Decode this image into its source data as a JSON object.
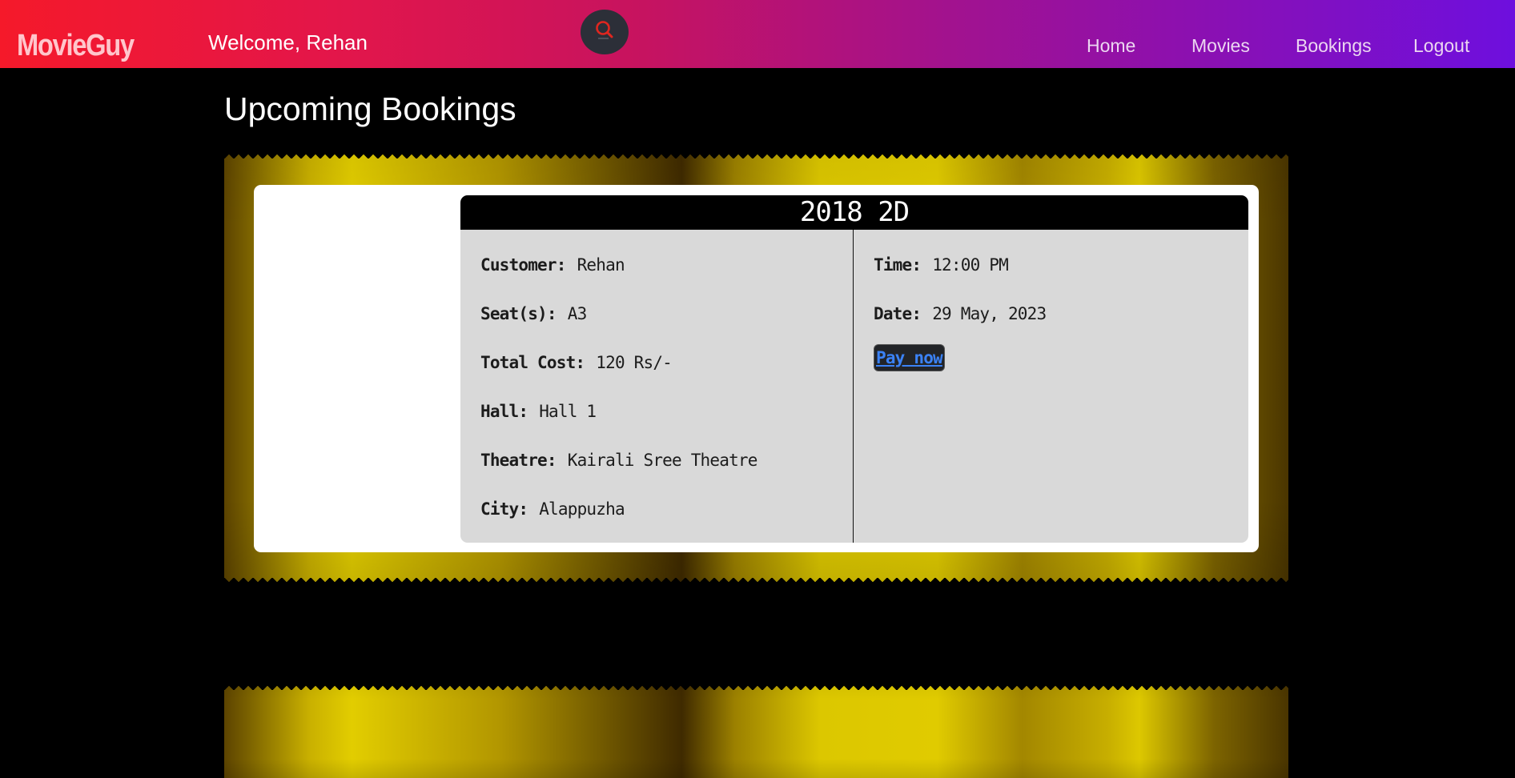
{
  "header": {
    "logo": "MovieGuy",
    "welcome": "Welcome, Rehan",
    "search_icon": "search-icon",
    "nav": {
      "home": "Home",
      "movies": "Movies",
      "bookings": "Bookings",
      "logout": "Logout"
    }
  },
  "main": {
    "title": "Upcoming Bookings"
  },
  "bookings": [
    {
      "movie": "2018 2D",
      "customer_label": "Customer:",
      "customer": "Rehan",
      "seats_label": "Seat(s):",
      "seats": "A3",
      "cost_label": "Total Cost:",
      "cost": "120 Rs/-",
      "hall_label": "Hall:",
      "hall": "Hall 1",
      "theatre_label": "Theatre:",
      "theatre": "Kairali Sree Theatre",
      "city_label": "City:",
      "city": "Alappuzha",
      "time_label": "Time:",
      "time": "12:00 PM",
      "date_label": "Date:",
      "date": "29 May, 2023",
      "pay_label": "Pay now"
    }
  ],
  "colors": {
    "header_gradient_start": "#f5192a",
    "header_gradient_end": "#6e0fde",
    "ticket_gold": "#e2cd00",
    "card_bg": "#d9d9d9",
    "link_blue": "#3b82f6"
  }
}
